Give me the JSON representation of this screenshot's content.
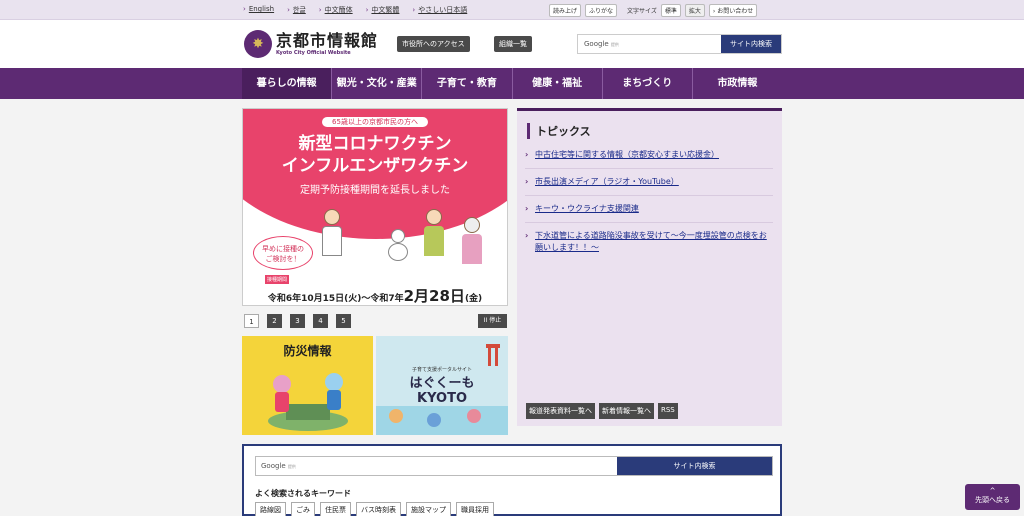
{
  "util": {
    "links": [
      "English",
      "한글",
      "中文簡体",
      "中文繁體",
      "やさしい日本語"
    ],
    "read_aloud": "読み上げ",
    "furigana": "ふりがな",
    "text_size_label": "文字サイズ",
    "standard": "標準",
    "enlarge": "拡大",
    "contact": "お問い合わせ"
  },
  "header": {
    "title": "京都市情報館",
    "subtitle": "Kyoto City Official Website",
    "access_button": "市役所へのアクセス",
    "org_button": "組織一覧",
    "search_google": "Google",
    "search_google_sub": "提供",
    "search_button": "サイト内検索"
  },
  "nav": {
    "items": [
      "暮らしの情報",
      "観光・文化・産業",
      "子育て・教育",
      "健康・福祉",
      "まちづくり",
      "市政情報"
    ]
  },
  "banner": {
    "pre": "65歳以上の京都市民の方へ",
    "line1": "新型コロナワクチン",
    "line2": "インフルエンザワクチン",
    "line3": "定期予防接種期間を延長しました",
    "bubble1": "早めに接種の",
    "bubble2": "ご検討を！",
    "period_tag": "接種期間",
    "period_prefix": "令和6年10月15日(火)～令和7年",
    "period_bold": "2月28日",
    "period_suffix": "(金)"
  },
  "pager": {
    "pages": [
      "1",
      "2",
      "3",
      "4",
      "5"
    ],
    "pause": "II 停止"
  },
  "tiles": {
    "disaster": "防災情報",
    "hug_sub": "子育て支援ポータルサイト",
    "hug_line1": "はぐくーも",
    "hug_line2": "KYOTO"
  },
  "topics": {
    "title": "トピックス",
    "items": [
      "中古住宅等に関する情報（京都安心すまい応援金）",
      "市長出演メディア（ラジオ・YouTube）",
      "キーウ・ウクライナ支援関連",
      "下水道管による道路陥没事故を受けて～今一度埋設管の点検をお願いします！！～"
    ],
    "buttons": [
      "報道発表資料一覧へ",
      "新着情報一覧へ",
      "RSS"
    ]
  },
  "search_box": {
    "google": "Google",
    "google_sub": "提供",
    "button": "サイト内検索",
    "keywords_title": "よく検索されるキーワード",
    "keywords": [
      "路線図",
      "ごみ",
      "住民票",
      "バス時刻表",
      "施設マップ",
      "職員採用"
    ]
  },
  "to_top": {
    "arrow": "^",
    "label": "先頭へ戻る"
  },
  "colors": {
    "brand": "#5d2a73",
    "search_blue": "#2a3b7a",
    "banner_pink": "#e8436b"
  }
}
